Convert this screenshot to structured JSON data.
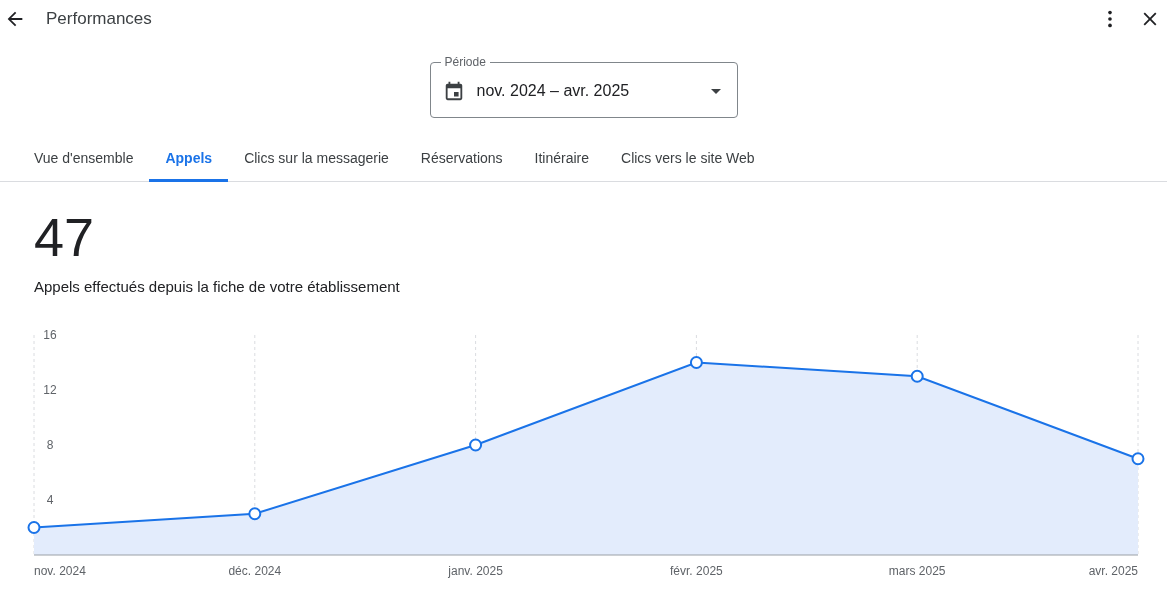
{
  "header": {
    "title": "Performances"
  },
  "period": {
    "label": "Période",
    "value": "nov. 2024 – avr. 2025"
  },
  "tabs": [
    {
      "label": "Vue d'ensemble",
      "selected": false
    },
    {
      "label": "Appels",
      "selected": true
    },
    {
      "label": "Clics sur la messagerie",
      "selected": false
    },
    {
      "label": "Réservations",
      "selected": false
    },
    {
      "label": "Itinéraire",
      "selected": false
    },
    {
      "label": "Clics vers le site Web",
      "selected": false
    }
  ],
  "metric": {
    "value": "47",
    "caption": "Appels effectués depuis la fiche de votre établissement"
  },
  "chart_data": {
    "type": "area",
    "categories": [
      "nov. 2024",
      "déc. 2024",
      "janv. 2025",
      "févr. 2025",
      "mars 2025",
      "avr. 2025"
    ],
    "series": [
      {
        "color": "#1a73e8",
        "values": [
          2,
          3,
          8,
          14,
          13,
          7
        ]
      }
    ],
    "grid": true,
    "ylim": [
      0,
      16
    ],
    "yticks": [
      4,
      8,
      12,
      16
    ]
  }
}
